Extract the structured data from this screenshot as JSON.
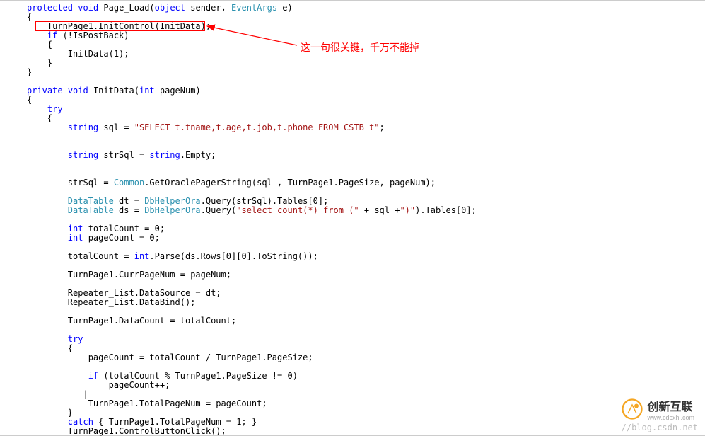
{
  "code": {
    "l1_kw1": "protected",
    "l1_kw2": "void",
    "l1_fn": " Page_Load(",
    "l1_kw3": "object",
    "l1_p1": " sender, ",
    "l1_type": "EventArgs",
    "l1_p2": " e)",
    "l2": "{",
    "l3": "    TurnPage1.InitControl(InitData);",
    "l4_kw": "if",
    "l4": " (!IsPostBack)",
    "l5": "    {",
    "l6": "        InitData(1);",
    "l7": "    }",
    "l8": "}",
    "l10_kw1": "private",
    "l10_kw2": "void",
    "l10_fn": " InitData(",
    "l10_kw3": "int",
    "l10_p": " pageNum)",
    "l11": "{",
    "l12_kw": "try",
    "l12": "",
    "l13": "    {",
    "l14_kw": "string",
    "l14_v": " sql = ",
    "l14_str": "\"SELECT t.tname,t.age,t.job,t.phone FROM CSTB t\"",
    "l14_e": ";",
    "l16_kw": "string",
    "l16_v": " strSql = ",
    "l16_kw2": "string",
    "l16_e": ".Empty;",
    "l18_v": "        strSql = ",
    "l18_type": "Common",
    "l18_e": ".GetOraclePagerString(sql , TurnPage1.PageSize, pageNum);",
    "l20_type": "DataTable",
    "l20_v": " dt = ",
    "l20_type2": "DbHelperOra",
    "l20_e": ".Query(strSql).Tables[0];",
    "l21_type": "DataTable",
    "l21_v": " ds = ",
    "l21_type2": "DbHelperOra",
    "l21_m": ".Query(",
    "l21_str": "\"select count(*) from (\"",
    "l21_p": " + sql +",
    "l21_str2": "\")\"",
    "l21_e": ").Tables[0];",
    "l23_kw": "int",
    "l23": " totalCount = 0;",
    "l24_kw": "int",
    "l24": " pageCount = 0;",
    "l26_v": "        totalCount = ",
    "l26_kw": "int",
    "l26_e": ".Parse(ds.Rows[0][0].ToString());",
    "l28": "        TurnPage1.CurrPageNum = pageNum;",
    "l30": "        Repeater_List.DataSource = dt;",
    "l31": "        Repeater_List.DataBind();",
    "l33": "        TurnPage1.DataCount = totalCount;",
    "l35_kw": "try",
    "l36": "        {",
    "l37": "            pageCount = totalCount / TurnPage1.PageSize;",
    "l39_kw": "if",
    "l39": " (totalCount % TurnPage1.PageSize != 0)",
    "l40": "                pageCount++;",
    "l41": "           |",
    "l42": "            TurnPage1.TotalPageNum = pageCount;",
    "l43": "        }",
    "l44_kw": "catch",
    "l44": " { TurnPage1.TotalPageNum = 1; }",
    "l45": "        TurnPage1.ControlButtonClick();"
  },
  "annotation": "这一句很关键，千万不能掉",
  "watermark_url": "//blog.csdn.net",
  "logo": {
    "text": "创新互联",
    "sub": "www.cdcxhl.com"
  },
  "colors": {
    "keyword": "#0000FF",
    "type": "#2B91AF",
    "string": "#A31515",
    "annotation": "#FF0000"
  }
}
